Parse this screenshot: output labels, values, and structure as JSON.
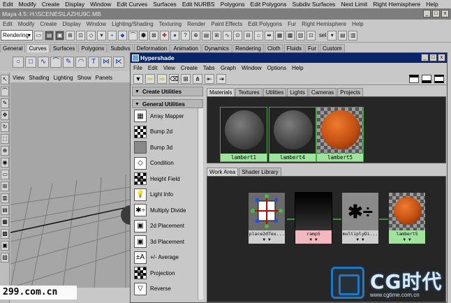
{
  "menubar": {
    "items": [
      "Edit",
      "Modify",
      "Create",
      "Display",
      "Window",
      "Edit Curves",
      "Surfaces",
      "Edit NURBS",
      "Polygons",
      "Edit Polygons",
      "Subdiv Surfaces",
      "Next Limit",
      "Right Hemisphere",
      "Help"
    ]
  },
  "window": {
    "title": "Maya 4.5: H:\\SCENES\\LAZHU9C.MB"
  },
  "menubar2": {
    "items": [
      "Edit",
      "Modify",
      "Create",
      "Display",
      "Window",
      "Lighting/Shading",
      "Texturing",
      "Render",
      "Paint Effects",
      "Edit Polygons",
      "Fur",
      "Right Hemisphere",
      "Help"
    ]
  },
  "statusline": {
    "mode": "Rendering",
    "sel_label": "sel"
  },
  "shelf_tabs": [
    "General",
    "Curves",
    "Surfaces",
    "Polygons",
    "Subdivs",
    "Deformation",
    "Animation",
    "Dynamics",
    "Rendering",
    "Cloth",
    "Fluids",
    "Fur",
    "Custom"
  ],
  "shelf_active": "Curves",
  "viewport_menu": [
    "View",
    "Shading",
    "Lighting",
    "Show",
    "Panels"
  ],
  "hypershade": {
    "title": "Hypershade",
    "menu": [
      "File",
      "Edit",
      "View",
      "Create",
      "Tabs",
      "Graph",
      "Window",
      "Options",
      "Help"
    ],
    "create_header": "Create Utilities",
    "general_header": "General Utilities",
    "utilities": [
      {
        "label": "Array Mapper",
        "icon": "array-mapper-icon"
      },
      {
        "label": "Bump 2d",
        "icon": "bump-2d-icon"
      },
      {
        "label": "Bump 3d",
        "icon": "bump-3d-icon"
      },
      {
        "label": "Condition",
        "icon": "condition-icon"
      },
      {
        "label": "Height Field",
        "icon": "height-field-icon"
      },
      {
        "label": "Light Info",
        "icon": "light-info-icon"
      },
      {
        "label": "Multiply Divide",
        "icon": "multiply-divide-icon"
      },
      {
        "label": "2d Placement",
        "icon": "2d-placement-icon"
      },
      {
        "label": "3d Placement",
        "icon": "3d-placement-icon"
      },
      {
        "label": "+/- Average",
        "icon": "plus-minus-average-icon"
      },
      {
        "label": "Projection",
        "icon": "projection-icon"
      },
      {
        "label": "Reverse",
        "icon": "reverse-icon"
      }
    ],
    "mat_tabs": [
      "Materials",
      "Textures",
      "Utilities",
      "Lights",
      "Cameras",
      "Projects"
    ],
    "mat_active": "Materials",
    "swatches": [
      {
        "label": "lambert1",
        "type": "gray"
      },
      {
        "label": "lambert4",
        "type": "gray"
      },
      {
        "label": "lambert5",
        "type": "orange"
      }
    ],
    "work_tabs": [
      "Work Area",
      "Shader Library"
    ],
    "work_active": "Work Area",
    "nodes": [
      {
        "label": "place2dTex...",
        "kind": "place"
      },
      {
        "label": "ramp5",
        "kind": "ramp"
      },
      {
        "label": "multiplyDi...",
        "kind": "mult"
      },
      {
        "label": "lambert5",
        "kind": "lam"
      }
    ]
  },
  "watermarks": {
    "left": "299.com.cn",
    "brand": "CG时代",
    "url": "www.cgtime.com.cn"
  },
  "colors": {
    "title_bar": "#0a246a",
    "swatch_label": "#9fe39f",
    "ramp_label": "#f2b8bf",
    "work_bg": "#262626"
  }
}
